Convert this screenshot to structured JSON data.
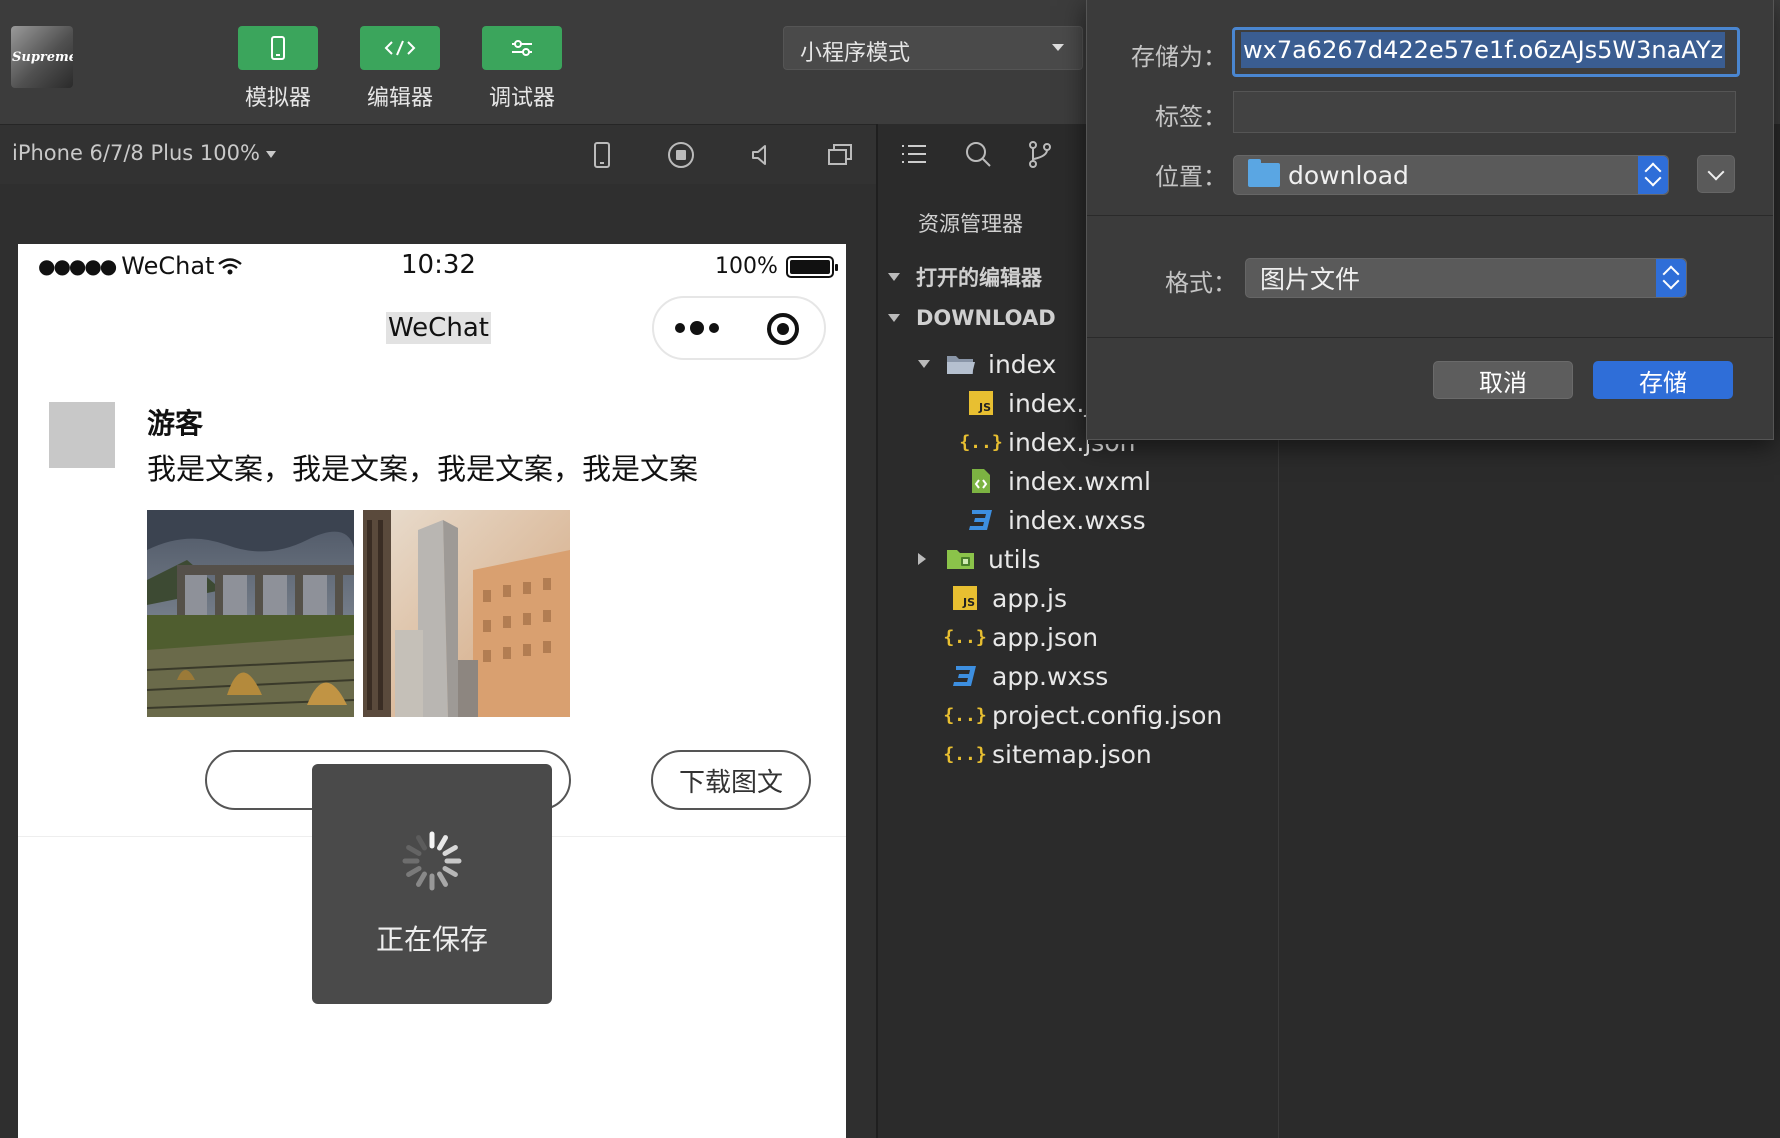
{
  "toolbar": {
    "avatar_text": "Supreme",
    "simulator_label": "模拟器",
    "editor_label": "编辑器",
    "debugger_label": "调试器",
    "mode_select": "小程序模式"
  },
  "simulator_bar": {
    "device": "iPhone 6/7/8 Plus 100%"
  },
  "phone": {
    "status": {
      "carrier": "WeChat",
      "time": "10:32",
      "battery": "100%"
    },
    "nav_title": "WeChat",
    "post": {
      "user": "游客",
      "text": "我是文案，我是文案，我是文案，我是文案",
      "download_button": "下载图文"
    },
    "toast": {
      "message": "正在保存"
    }
  },
  "explorer": {
    "title": "资源管理器",
    "open_editors": "打开的编辑器",
    "project": "DOWNLOAD",
    "items": [
      {
        "name": "index",
        "type": "folder-open"
      },
      {
        "name": "index.js",
        "type": "js"
      },
      {
        "name": "index.json",
        "type": "json"
      },
      {
        "name": "index.wxml",
        "type": "wxml"
      },
      {
        "name": "index.wxss",
        "type": "wxss"
      },
      {
        "name": "utils",
        "type": "folder"
      },
      {
        "name": "app.js",
        "type": "js"
      },
      {
        "name": "app.json",
        "type": "json"
      },
      {
        "name": "app.wxss",
        "type": "wxss"
      },
      {
        "name": "project.config.json",
        "type": "json"
      },
      {
        "name": "sitemap.json",
        "type": "json"
      }
    ]
  },
  "save_dialog": {
    "save_as_label": "存储为：",
    "filename": "wx7a6267d422e57e1f.o6zAJs5W3naAYz",
    "tags_label": "标签：",
    "tags_value": "",
    "location_label": "位置：",
    "location": "download",
    "format_label": "格式：",
    "format": "图片文件",
    "cancel": "取消",
    "save": "存储"
  },
  "colors": {
    "accent_green": "#3ba55c",
    "primary_blue": "#2f6ed8",
    "json_yellow": "#e8bf31",
    "wxss_blue": "#3d8fe0",
    "wxml_green": "#7cb342"
  }
}
